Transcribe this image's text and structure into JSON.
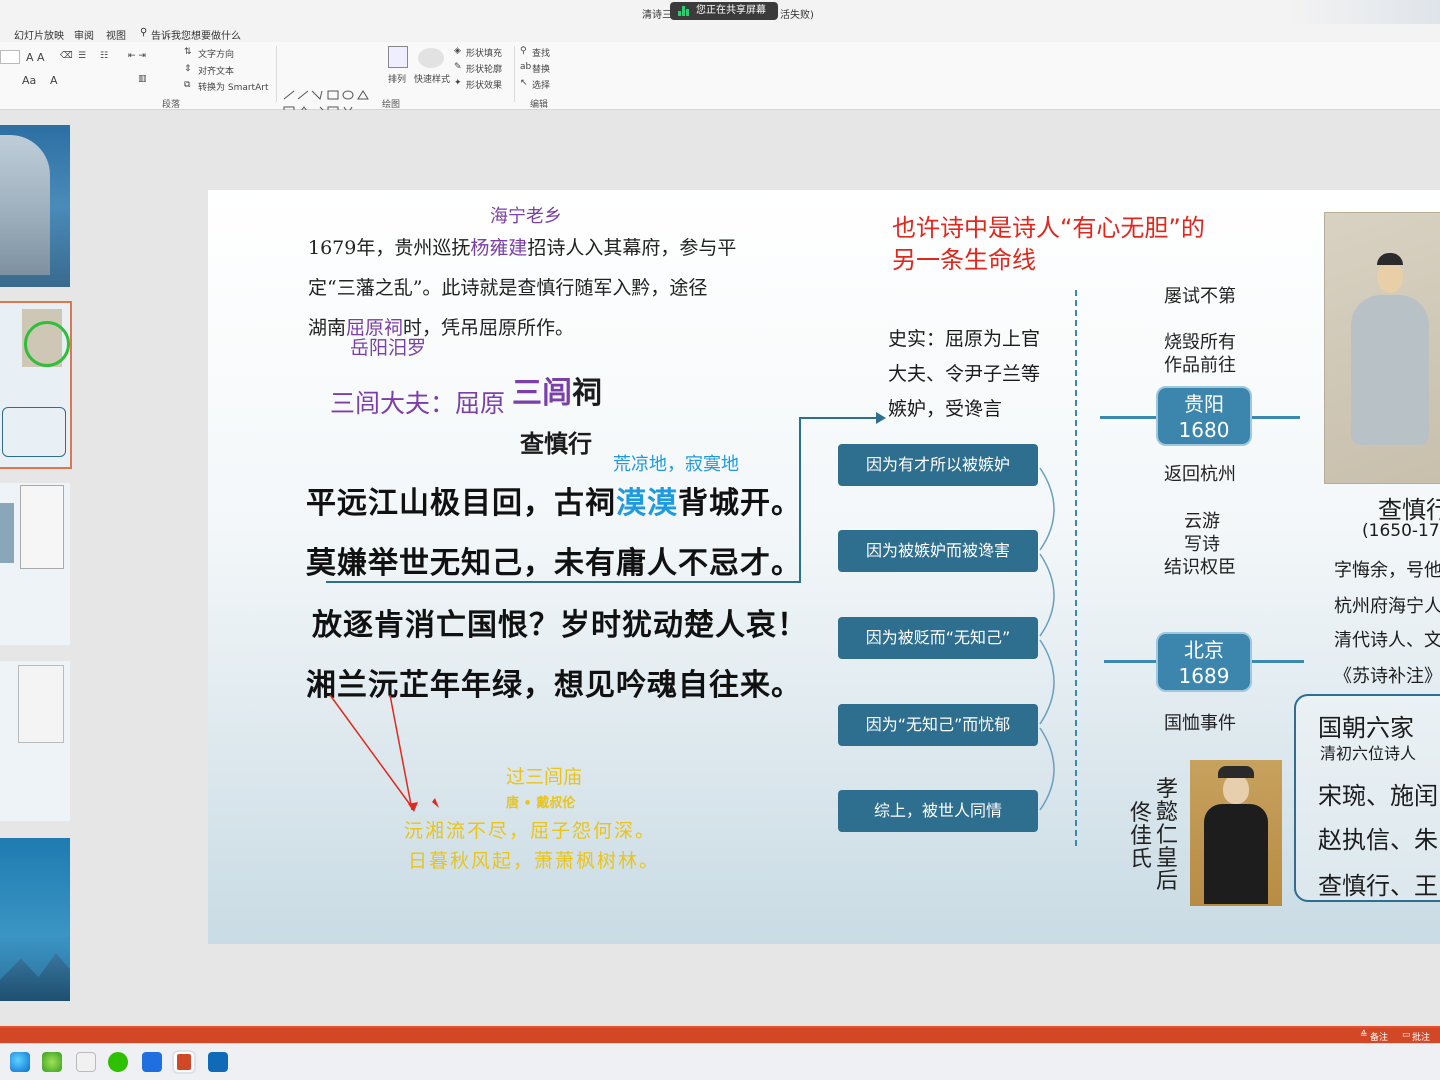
{
  "titlebar": {
    "doc_title_left": "清诗三",
    "recording_label": "您正在共享屏幕",
    "doc_title_right": "活失败)"
  },
  "ribbon": {
    "tabs": [
      "幻灯片放映",
      "审阅",
      "视图"
    ],
    "tell_me": "告诉我您想要做什么",
    "paragraph": {
      "text_direction": "文字方向",
      "align_text": "对齐文本",
      "smartart": "转换为 SmartArt",
      "group_label": "段落"
    },
    "drawing": {
      "arrange": "排列",
      "quick_styles": "快速样式",
      "shape_fill": "形状填充",
      "shape_outline": "形状轮廓",
      "shape_effects": "形状效果",
      "group_label": "绘图"
    },
    "editing": {
      "find": "查找",
      "replace": "替换",
      "select": "选择",
      "group_label": "编辑"
    },
    "font_size_a": "A A",
    "aa_label": "Aa"
  },
  "slide": {
    "hometown_note": "海宁老乡",
    "intro_line1_pre": "1679年，贵州巡抚",
    "intro_line1_name": "杨雍建",
    "intro_line1_post": "招诗人入其幕府，参与平",
    "intro_line2": "定“三藩之乱”。此诗就是查慎行随军入黔，途径",
    "intro_line3_pre": "湖南",
    "intro_line3_place": "屈原祠",
    "intro_line3_post": "时，凭吊屈原所作。",
    "place_note": "岳阳汨罗",
    "sanlv_label": "三闾大夫：屈原",
    "poem_title_a": "三闾",
    "poem_title_b": "祠",
    "poem_author": "查慎行",
    "desolate_note": "荒凉地，寂寞地",
    "poem_line1_a": "平远江山极目回，古祠",
    "poem_line1_b": "漠漠",
    "poem_line1_c": "背城开。",
    "poem_line2": "莫嫌举世无知己，未有庸人不忌才。",
    "poem_line3": "放逐肯消亡国恨？岁时犹动楚人哀！",
    "poem_line4": "湘兰沅芷年年绿，想见吟魂自往来。",
    "ref_title": "过三闾庙",
    "ref_author": "唐 • 戴叔伦",
    "ref_line1": "沅湘流不尽，屈子怨何深。",
    "ref_line2": "日暮秋风起，萧萧枫树林。",
    "heading_line1": "也许诗中是诗人“有心无胆”的",
    "heading_line2": "另一条生命线",
    "history_line1": "史实：屈原为上官",
    "history_line2": "大夫、令尹子兰等",
    "history_line3": "嫉妒，受谗言",
    "reasons": [
      "因为有才所以被嫉妒",
      "因为被嫉妒而被谗害",
      "因为被贬而“无知己”",
      "因为“无知己”而忧郁",
      "综上，被世人同情"
    ],
    "timeline": {
      "failed_exams": "屡试不第",
      "burned_line1": "烧毁所有",
      "burned_line2": "作品前往",
      "city1_name": "贵阳",
      "city1_year": "1680",
      "return": "返回杭州",
      "travel1": "云游",
      "travel2": "写诗",
      "travel3": "结识权臣",
      "city2_name": "北京",
      "city2_year": "1689",
      "incident": "国恤事件",
      "empress_col1": "孝懿仁皇后",
      "empress_col2": "佟佳氏"
    },
    "bio": {
      "name": "查慎行",
      "years": "(1650-17",
      "line1": "字悔余，号他",
      "line2": "杭州府海宁人",
      "line3": "清代诗人、文",
      "line4": "《苏诗补注》"
    },
    "six": {
      "title": "国朝六家",
      "subtitle": "清初六位诗人",
      "line1": "宋琬、施闰",
      "line2": "赵执信、朱",
      "line3": "查慎行、王"
    }
  },
  "status": {
    "notes_label": "备注",
    "comments_label": "批注"
  },
  "colors": {
    "accent_orange": "#d24726",
    "slide_purple": "#7b3fa8",
    "slide_red": "#e0271d",
    "slide_blue": "#1e9be0",
    "reason_box": "#2e6e8f",
    "ref_poem_yellow": "#e9c41a"
  }
}
